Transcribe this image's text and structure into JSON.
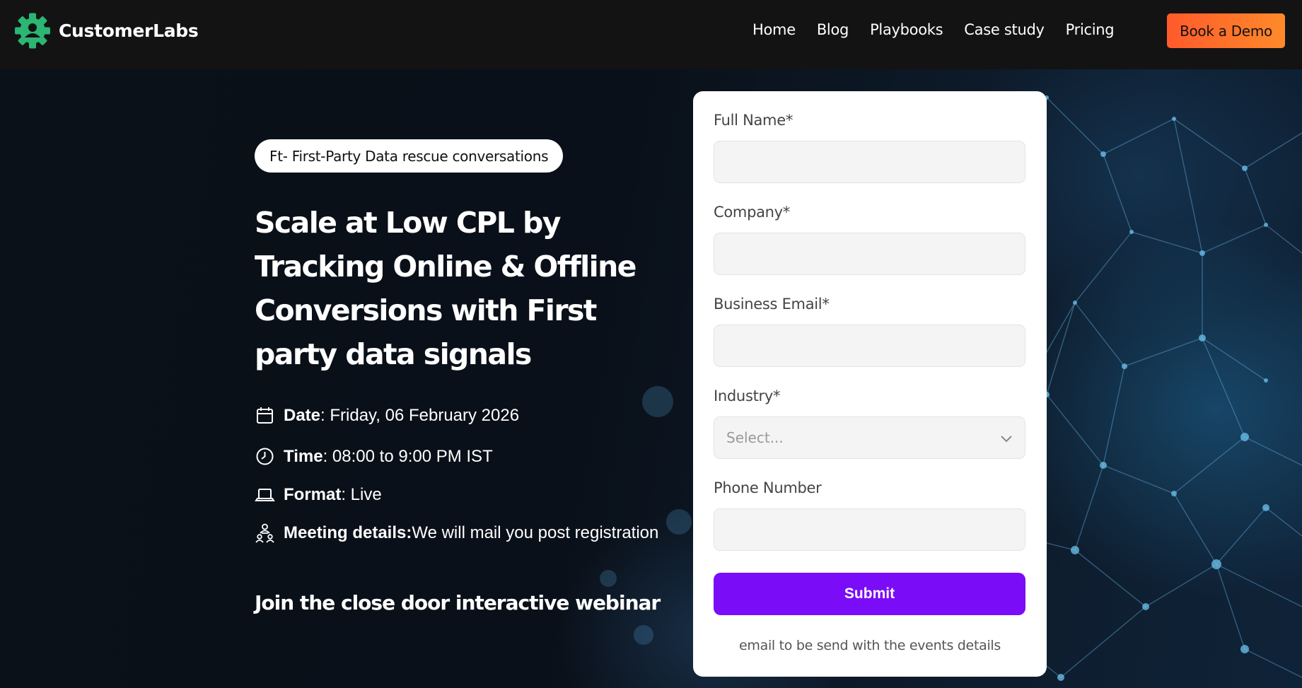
{
  "brand": {
    "name": "CustomerLabs",
    "accent": "#2bb673"
  },
  "nav": {
    "links": [
      "Home",
      "Blog",
      "Playbooks",
      "Case study",
      "Pricing"
    ],
    "demo_label": "Book a Demo",
    "demo_color": "#ff6a2b"
  },
  "hero": {
    "pill": "Ft- First-Party Data rescue conversations",
    "headline": "Scale at Low CPL by Tracking Online & Offline Conversions with First party data signals",
    "details": [
      {
        "icon": "calendar-icon",
        "label": "Date",
        "value": ": Friday, 06 February 2026"
      },
      {
        "icon": "clock-icon",
        "label": "Time",
        "value": ": 08:00 to 9:00 PM IST"
      },
      {
        "icon": "laptop-icon",
        "label": "Format",
        "value": ": Live"
      },
      {
        "icon": "meeting-icon",
        "label": "Meeting details:",
        "value": " We will mail you post registration"
      }
    ],
    "join": "Join the close door interactive webinar"
  },
  "form": {
    "full_name_label": "Full Name*",
    "company_label": "Company*",
    "email_label": "Business Email*",
    "industry_label": "Industry*",
    "industry_placeholder": "Select...",
    "phone_label": "Phone Number",
    "submit_label": "Submit",
    "submit_color": "#7a0cf7",
    "note": "email to be send with the events details"
  }
}
